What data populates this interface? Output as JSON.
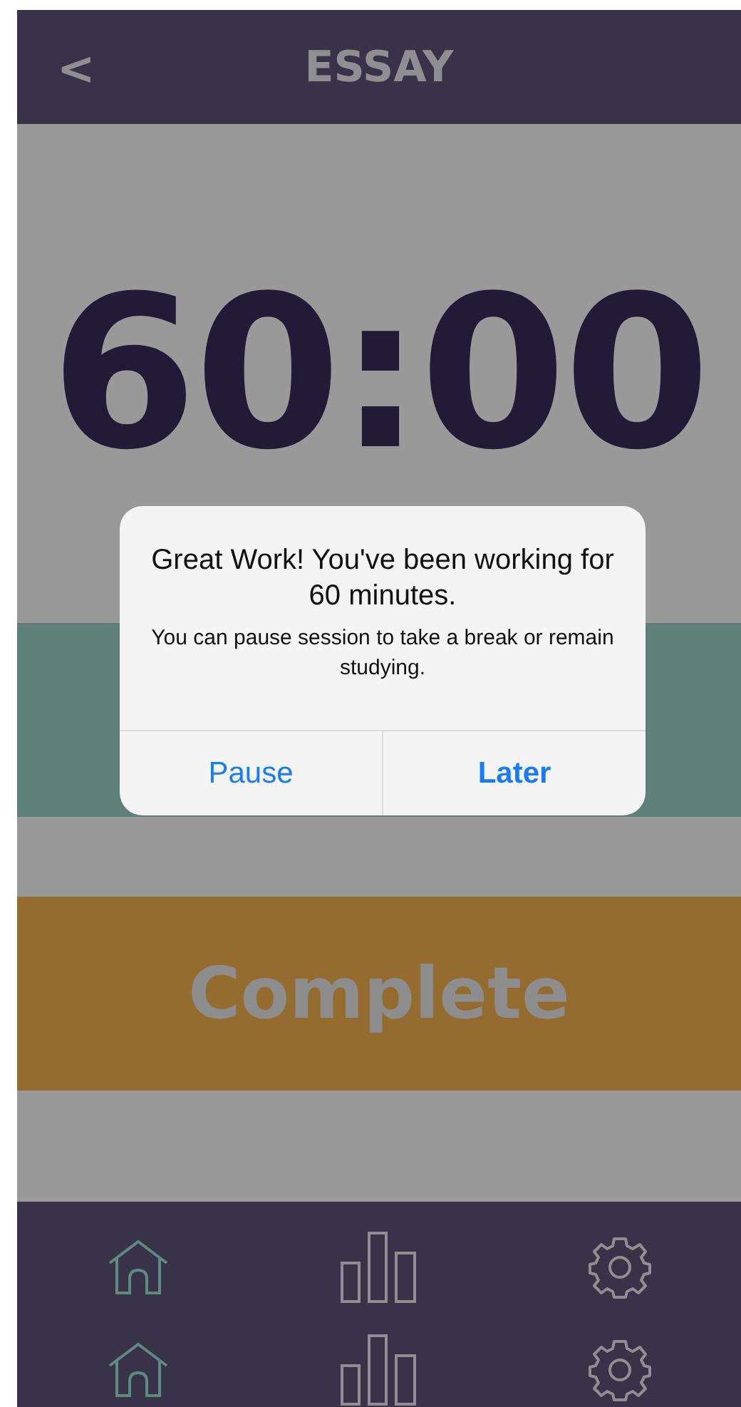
{
  "header": {
    "back": "<",
    "title": "ESSAY"
  },
  "timer": "60:00",
  "complete_button": "Complete",
  "alert": {
    "title": "Great Work! You've been working for 60 minutes.",
    "message": "You can pause session to take a break or remain studying.",
    "buttons": [
      {
        "label": "Pause",
        "preferred": false
      },
      {
        "label": "Later",
        "preferred": true
      }
    ]
  },
  "tab_rows": [
    [
      {
        "kind": "home",
        "selected": true
      },
      {
        "kind": "stats",
        "selected": false
      },
      {
        "kind": "settings",
        "selected": false
      }
    ],
    [
      {
        "kind": "home",
        "selected": true
      },
      {
        "kind": "stats",
        "selected": false
      },
      {
        "kind": "settings",
        "selected": false
      }
    ]
  ]
}
